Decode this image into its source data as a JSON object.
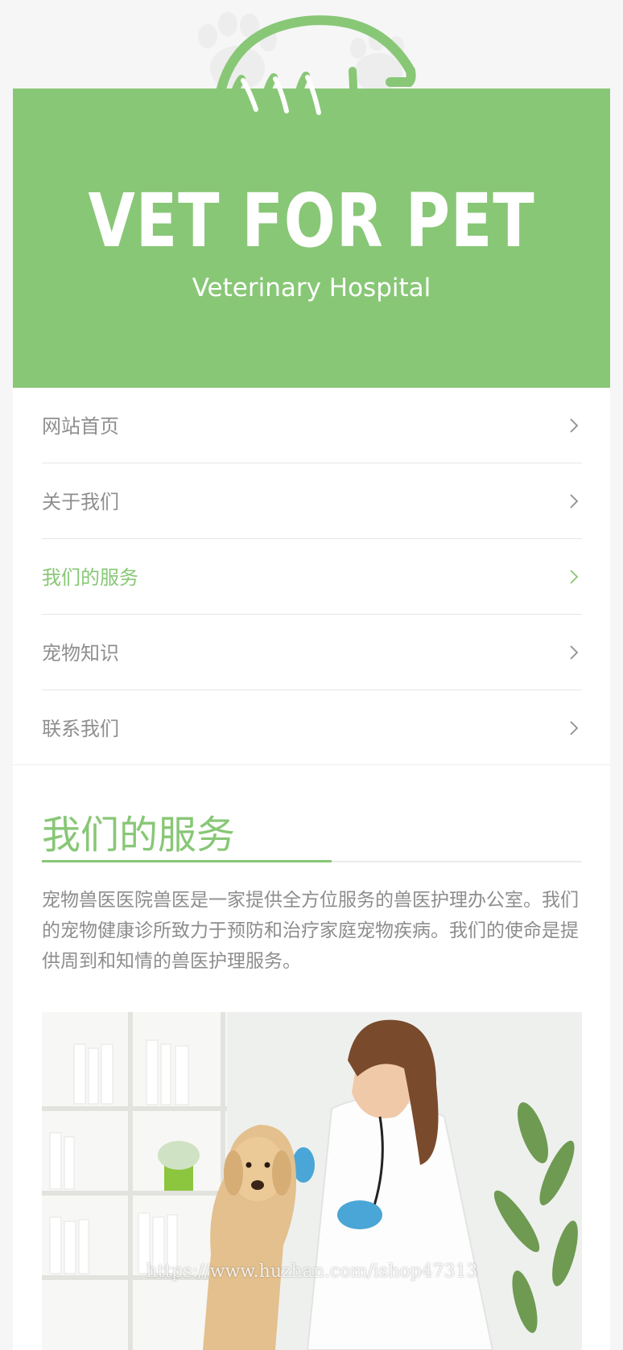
{
  "hero": {
    "title": "VET FOR PET",
    "subtitle": "Veterinary Hospital"
  },
  "nav": {
    "items": [
      {
        "label": "网站首页",
        "active": false
      },
      {
        "label": "关于我们",
        "active": false
      },
      {
        "label": "我们的服务",
        "active": true
      },
      {
        "label": "宠物知识",
        "active": false
      },
      {
        "label": "联系我们",
        "active": false
      }
    ]
  },
  "services": {
    "title": "我们的服务",
    "description": "宠物兽医医院兽医是一家提供全方位服务的兽医护理办公室。我们的宠物健康诊所致力于预防和治疗家庭宠物疾病。我们的使命是提供周到和知情的兽医护理服务。"
  },
  "photo": {
    "watermark": "https://www.huzhan.com/ishop47313"
  },
  "colors": {
    "accent": "#88c776",
    "text_muted": "#8f8f8f",
    "background": "#f6f6f6"
  }
}
